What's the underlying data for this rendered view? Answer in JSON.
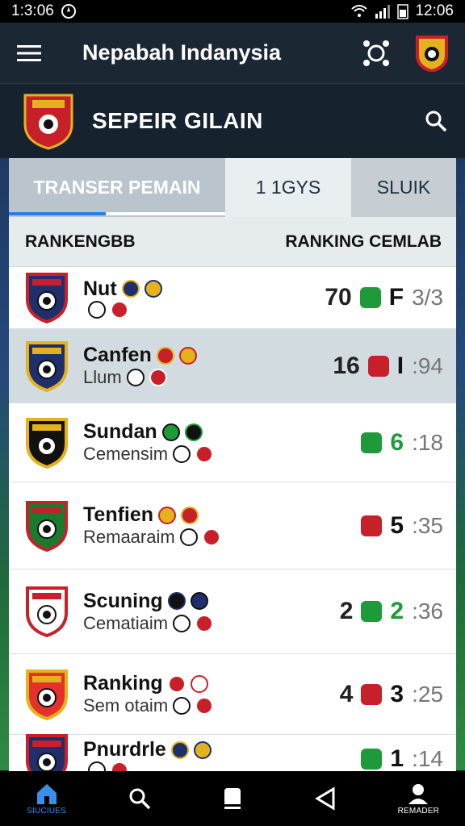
{
  "status_bar": {
    "time_left": "1:3:06",
    "time_right": "12:06"
  },
  "app_bar": {
    "title": "Nepabah Indanysia"
  },
  "club_header": {
    "title": "SEPEIR GILAIN"
  },
  "tabs": [
    {
      "label": "TRANSER PEMAIN"
    },
    {
      "label": "1 1GYS"
    },
    {
      "label": "SLUIK"
    }
  ],
  "columns": {
    "left": "RANKENGBB",
    "right": "RANKING CEMLAB"
  },
  "rows": [
    {
      "name": "Nut",
      "sub": "",
      "score_a": "70",
      "score_b": "F",
      "time": "3/3",
      "crest_colors": [
        "#1e2f6b",
        "#c8202a"
      ]
    },
    {
      "name": "Canfen",
      "sub": "Llum",
      "score_a": "16",
      "score_b": "I",
      "time": ":94",
      "crest_colors": [
        "#1e2f6b",
        "#e4b21d"
      ]
    },
    {
      "name": "Sundan",
      "sub": "Cemensim",
      "score_a": "",
      "score_b": "6",
      "time": ":18",
      "crest_colors": [
        "#111111",
        "#e4b21d"
      ]
    },
    {
      "name": "Tenfien",
      "sub": "Remaaraim",
      "score_a": "",
      "score_b": "5",
      "time": ":35",
      "crest_colors": [
        "#1a7a2e",
        "#c8202a"
      ]
    },
    {
      "name": "Scuning",
      "sub": "Cematiaim",
      "score_a": "2",
      "score_b": "2",
      "time": ":36",
      "crest_colors": [
        "#ffffff",
        "#c8202a"
      ]
    },
    {
      "name": "Ranking",
      "sub": "Sem otaim",
      "score_a": "4",
      "score_b": "3",
      "time": ":25",
      "crest_colors": [
        "#e4312b",
        "#e4b21d"
      ]
    },
    {
      "name": "Pnurdrle",
      "sub": "",
      "score_a": "",
      "score_b": "1",
      "time": ":14",
      "crest_colors": [
        "#1e2f6b",
        "#c8202a"
      ]
    }
  ],
  "bottom_nav": [
    {
      "label": "SIUCIUES",
      "icon": "home-icon"
    },
    {
      "label": "",
      "icon": "search-icon"
    },
    {
      "label": "",
      "icon": "card-icon"
    },
    {
      "label": "",
      "icon": "play-icon"
    },
    {
      "label": "REMADER",
      "icon": "profile-icon"
    }
  ],
  "colors": {
    "accent": "#2a7de1",
    "green": "#1f9a3a",
    "red": "#c8202a"
  }
}
